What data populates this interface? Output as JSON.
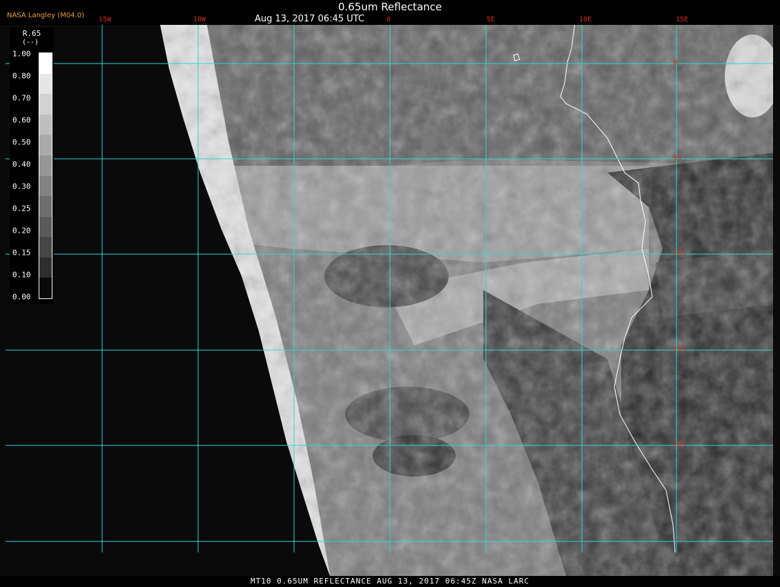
{
  "header": {
    "title": "0.65um Reflectance",
    "subtitle": "Aug 13, 2017 06:45 UTC",
    "agency": "NASA Langley (M04.0)"
  },
  "footer": {
    "text": "MT10  0.65UM REFLECTANCE   AUG 13, 2017 06:45Z   NASA LARC"
  },
  "grid": {
    "color": "#2fd6d6",
    "lon_labels": [
      "15W",
      "10W",
      "0",
      "5E",
      "10E",
      "15E"
    ],
    "lat_labels": [
      "0",
      "5S",
      "10S",
      "15S",
      "20S"
    ]
  },
  "legend": {
    "title": "R.65",
    "unit": "(--)",
    "ticks": [
      "1.00",
      "0.80",
      "0.70",
      "0.60",
      "0.50",
      "0.40",
      "0.30",
      "0.25",
      "0.20",
      "0.15",
      "0.10",
      "0.00"
    ],
    "colors": [
      "#ffffff",
      "#e6e6e6",
      "#d2d2d2",
      "#bebebe",
      "#aaaaaa",
      "#969696",
      "#828282",
      "#6e6e6e",
      "#5a5a5a",
      "#464646",
      "#2e2e2e",
      "#0a0a0a"
    ]
  },
  "map": {
    "coastline_color": "#ffffff",
    "space_color": "#0a0a0a"
  }
}
